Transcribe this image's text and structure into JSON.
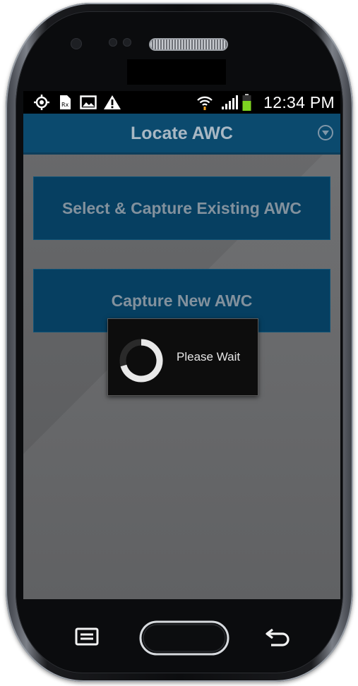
{
  "status_bar": {
    "time": "12:34 PM",
    "icons": [
      "gps-icon",
      "nfc-icon",
      "gallery-icon",
      "warning-icon",
      "wifi-icon",
      "signal-icon",
      "battery-icon"
    ],
    "battery_color": "#7ed321"
  },
  "action_bar": {
    "title": "Locate AWC",
    "menu_icon": "overflow-dropdown-icon",
    "background": "#0b4a6e"
  },
  "main": {
    "buttons": [
      {
        "label": "Select & Capture Existing AWC"
      },
      {
        "label": "Capture New AWC"
      }
    ]
  },
  "dialog": {
    "message": "Please Wait",
    "icon": "loading-spinner-icon"
  },
  "nav_bar": {
    "icons": [
      "menu-icon",
      "home-button",
      "back-icon"
    ]
  }
}
